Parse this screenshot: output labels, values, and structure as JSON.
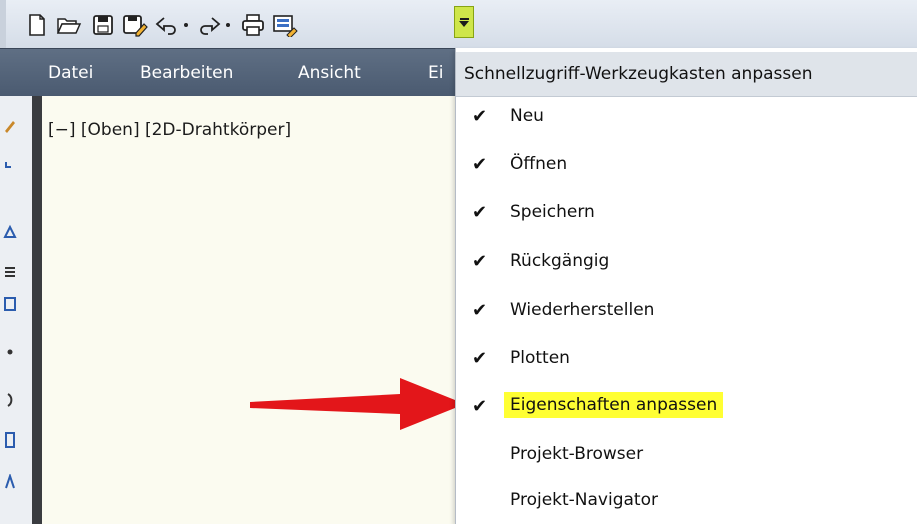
{
  "menubar": {
    "items": [
      "Datei",
      "Bearbeiten",
      "Ansicht",
      "Ei"
    ]
  },
  "viewport": {
    "label": "[−] [Oben] [2D-Drahtkörper]"
  },
  "dropdown": {
    "title": "Schnellzugriff-Werkzeugkasten anpassen",
    "check_glyph": "✔",
    "items": [
      {
        "label": "Neu",
        "checked": true
      },
      {
        "label": "Öffnen",
        "checked": true
      },
      {
        "label": "Speichern",
        "checked": true
      },
      {
        "label": "Rückgängig",
        "checked": true
      },
      {
        "label": "Wiederherstellen",
        "checked": true
      },
      {
        "label": "Plotten",
        "checked": true
      },
      {
        "label": "Eigenschaften anpassen",
        "checked": true,
        "highlighted": true
      },
      {
        "label": "Projekt-Browser",
        "checked": false
      },
      {
        "label": "Projekt-Navigator",
        "checked": false
      }
    ]
  },
  "colors": {
    "highlight": "#ffff33",
    "arrow": "#e3161a",
    "customize_button": "#cfe64a"
  }
}
